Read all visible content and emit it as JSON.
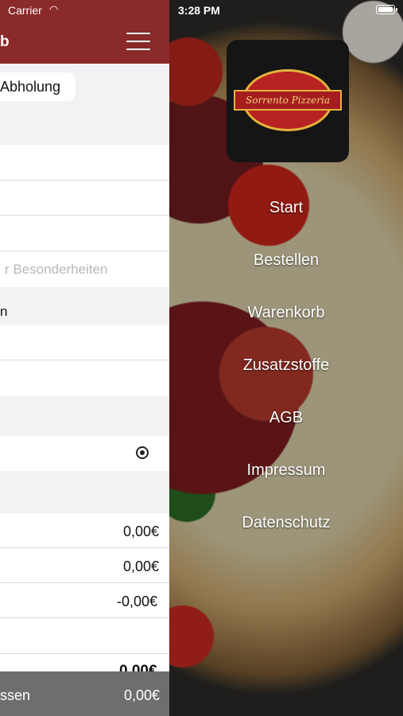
{
  "status_bar": {
    "carrier": "Carrier",
    "time": "3:28 PM"
  },
  "cart": {
    "title_partial": "b",
    "delivery_option_selected": "Abholung",
    "notes_placeholder_partial": "r Besonderheiten",
    "field_partial": "n",
    "summary_values": [
      "0,00€",
      "0,00€",
      "-0,00€"
    ],
    "total_partial": "0,00€",
    "footer_label_partial": "ssen",
    "footer_total": "0,00€"
  },
  "logo": {
    "text": "Sorrento Pizzeria"
  },
  "menu": {
    "items": [
      "Start",
      "Bestellen",
      "Warenkorb",
      "Zusatzstoffe",
      "AGB",
      "Impressum",
      "Datenschutz"
    ]
  }
}
